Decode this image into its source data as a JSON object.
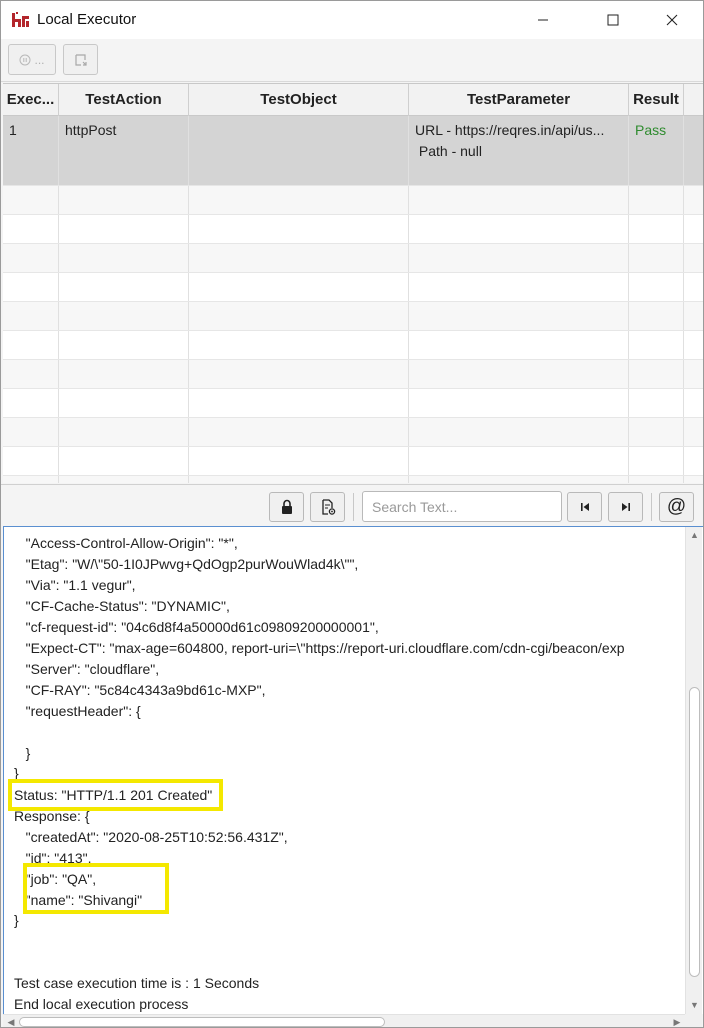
{
  "window": {
    "title": "Local Executor",
    "icon": "brand-logo-icon",
    "controls": [
      "minimize-icon",
      "maximize-icon",
      "close-icon"
    ]
  },
  "toolbar": {
    "pause_label": "...",
    "pause_icon": "pause-icon",
    "export_icon": "export-icon"
  },
  "table": {
    "columns": [
      "Exec...",
      "TestAction",
      "TestObject",
      "TestParameter",
      "Result"
    ],
    "rows": [
      {
        "exec": "1",
        "action": "httpPost",
        "object": "",
        "parameter_line1": "URL - https://reqres.in/api/us...",
        "parameter_line2": " Path - null",
        "result": "Pass"
      }
    ]
  },
  "log_toolbar": {
    "lock_icon": "lock-icon",
    "doc_icon": "document-settings-icon",
    "search_placeholder": "Search Text...",
    "first_icon": "skip-first-icon",
    "last_icon": "skip-last-icon",
    "at_label": "@"
  },
  "log": {
    "lines": [
      "   \"Access-Control-Allow-Origin\": \"*\",",
      "   \"Etag\": \"W/\\\"50-1I0JPwvg+QdOgp2purWouWlad4k\\\"\",",
      "   \"Via\": \"1.1 vegur\",",
      "   \"CF-Cache-Status\": \"DYNAMIC\",",
      "   \"cf-request-id\": \"04c6d8f4a50000d61c09809200000001\",",
      "   \"Expect-CT\": \"max-age=604800, report-uri=\\\"https://report-uri.cloudflare.com/cdn-cgi/beacon/exp",
      "   \"Server\": \"cloudflare\",",
      "   \"CF-RAY\": \"5c84c4343a9bd61c-MXP\",",
      "   \"requestHeader\": {",
      "",
      "   }",
      "}",
      "Status: \"HTTP/1.1 201 Created\"",
      "Response: {",
      "   \"createdAt\": \"2020-08-25T10:52:56.431Z\",",
      "   \"id\": \"413\",",
      "   \"job\": \"QA\",",
      "   \"name\": \"Shivangi\"",
      "}",
      "",
      "",
      "Test case execution time is : 1 Seconds",
      "End local execution process"
    ]
  }
}
